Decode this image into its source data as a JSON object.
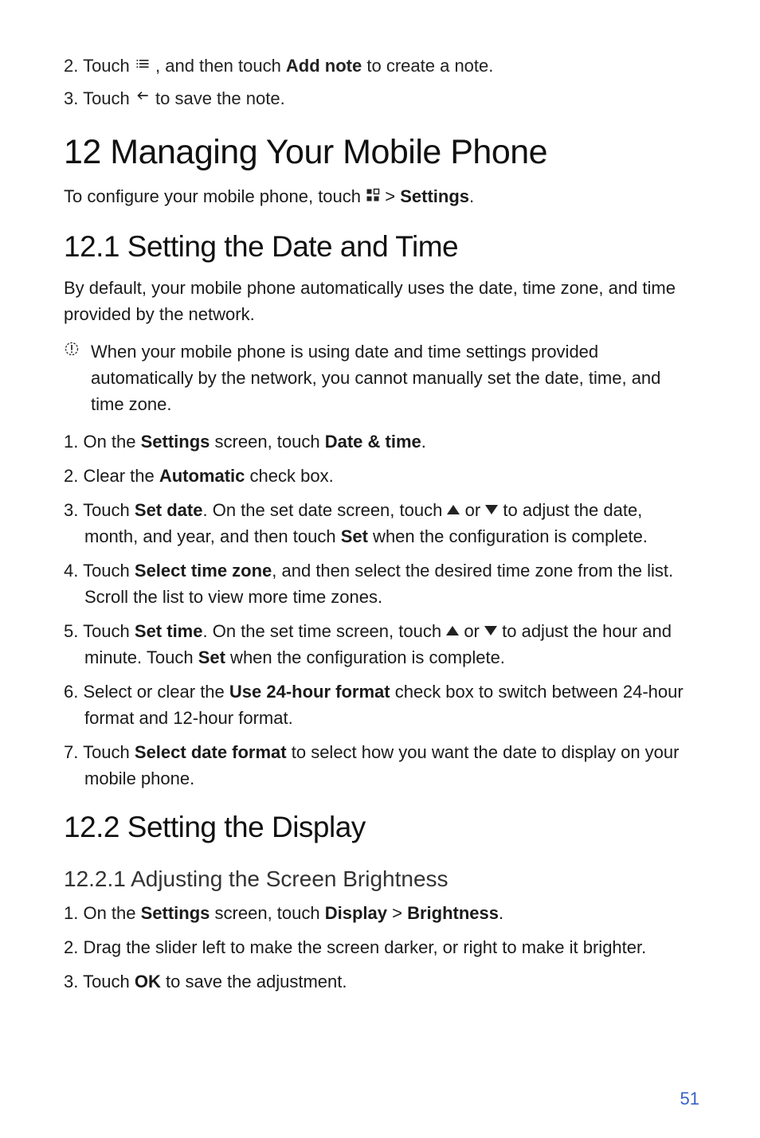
{
  "intro_steps": {
    "s2_a": "2. Touch ",
    "s2_b": " , and then touch ",
    "s2_bold": "Add note",
    "s2_c": " to create a note.",
    "s3_a": "3. Touch ",
    "s3_b": " to save the note."
  },
  "h1": "12  Managing Your Mobile Phone",
  "config_a": "To configure your mobile phone, touch ",
  "config_b": "  > ",
  "config_bold": "Settings",
  "config_c": ".",
  "h2_1": "12.1  Setting the Date and Time",
  "p1": "By default, your mobile phone automatically uses the date, time zone, and time provided by the network.",
  "note1": "When your mobile phone is using date and time settings provided automatically by the network, you cannot manually set the date, time, and time zone.",
  "dt_steps": {
    "s1_a": "1. On the ",
    "s1_b": "Settings",
    "s1_c": " screen, touch ",
    "s1_d": "Date & time",
    "s1_e": ".",
    "s2_a": "2. Clear the ",
    "s2_b": "Automatic",
    "s2_c": " check box.",
    "s3_a": "3. Touch ",
    "s3_b": "Set date",
    "s3_c": ". On the set date screen, touch ",
    "s3_or": " or ",
    "s3_d": " to adjust the date, month, and year, and then touch ",
    "s3_e": "Set",
    "s3_f": " when the configuration is complete.",
    "s4_a": "4. Touch ",
    "s4_b": "Select time zone",
    "s4_c": ", and then select the desired time zone from the list. Scroll the list to view more time zones.",
    "s5_a": "5. Touch ",
    "s5_b": "Set time",
    "s5_c": ". On the set time screen, touch ",
    "s5_or": " or ",
    "s5_d": " to adjust the hour and minute. Touch ",
    "s5_e": "Set",
    "s5_f": " when the configuration is complete.",
    "s6_a": "6. Select or clear the ",
    "s6_b": "Use 24-hour format",
    "s6_c": " check box to switch between 24-hour format and 12-hour format.",
    "s7_a": "7. Touch ",
    "s7_b": "Select date format",
    "s7_c": " to select how you want the date to display on your mobile phone."
  },
  "h2_2": "12.2  Setting the Display",
  "h3_1": "12.2.1  Adjusting the Screen Brightness",
  "disp_steps": {
    "s1_a": "1. On the ",
    "s1_b": "Settings",
    "s1_c": " screen, touch ",
    "s1_d": "Display",
    "s1_e": " > ",
    "s1_f": "Brightness",
    "s1_g": ".",
    "s2": "2. Drag the slider left to make the screen darker, or right to make it brighter.",
    "s3_a": "3. Touch ",
    "s3_b": "OK",
    "s3_c": " to save the adjustment."
  },
  "pagenum": "51"
}
